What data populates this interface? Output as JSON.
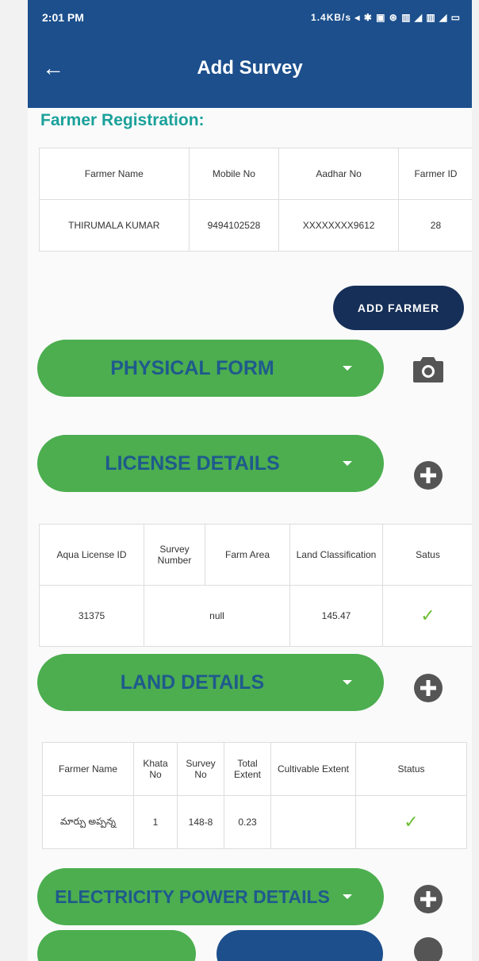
{
  "status": {
    "time": "2:01 PM",
    "indicators": "1.4KB/s  ◂ ✱ ▣ ⊛ ▥ ◢ ▥ ◢ ▭"
  },
  "app": {
    "title": "Add Survey"
  },
  "farmer_section": {
    "title": "Farmer Registration:",
    "headers": [
      "Farmer Name",
      "Mobile No",
      "Aadhar No",
      "Farmer ID"
    ],
    "row": [
      "THIRUMALA KUMAR",
      "9494102528",
      "XXXXXXXX9612",
      "28"
    ]
  },
  "add_farmer_label": "ADD FARMER",
  "physical_form_label": "PHYSICAL FORM",
  "license_details_label": "LICENSE DETAILS",
  "license_table": {
    "headers": [
      "Aqua License ID",
      "Survey Number",
      "Farm Area",
      "Land Classification",
      "Satus"
    ],
    "row": [
      "31375",
      "null",
      "145.47"
    ]
  },
  "land_details_label": "LAND DETAILS",
  "land_table": {
    "headers": [
      "Farmer Name",
      "Khata No",
      "Survey No",
      "Total Extent",
      "Cultivable Extent",
      "Status"
    ],
    "row": [
      "మార్పు అప్పన్న",
      "1",
      "148-8",
      "0.23",
      ""
    ]
  },
  "electricity_label": "ELECTRICITY POWER DETAILS",
  "colors": {
    "appbar": "#1c4f8c",
    "pill": "#4cae4f",
    "pill_text": "#1f5a8c",
    "section_title": "#1aa19a",
    "add_farmer_bg": "#162f58",
    "check": "#6cbf34"
  },
  "icons": [
    "back-arrow-icon",
    "camera-icon",
    "plus-circle-icon",
    "dropdown-caret-icon",
    "checkmark-icon"
  ]
}
